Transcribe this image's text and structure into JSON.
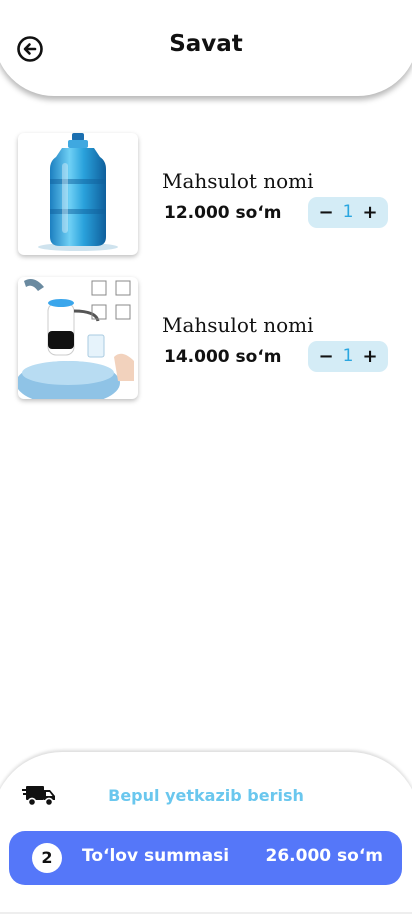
{
  "header": {
    "title": "Savat",
    "back_icon": "arrow-left-circle-icon"
  },
  "products": [
    {
      "name": "Mahsulot nomi",
      "price": "12.000 so‘m",
      "quantity": "1",
      "minus": "−",
      "plus": "+",
      "image": "water-bottle-image"
    },
    {
      "name": "Mahsulot nomi",
      "price": "14.000 so‘m",
      "quantity": "1",
      "minus": "−",
      "plus": "+",
      "image": "water-pump-image"
    }
  ],
  "footer": {
    "delivery_icon": "truck-icon",
    "delivery_text": "Bepul yetkazib berish",
    "item_count": "2",
    "pay_label": "To‘lov summasi",
    "total": "26.000 so‘m"
  },
  "colors": {
    "accent": "#5577f9",
    "stepper_bg": "#d4ecf6",
    "quantity": "#2aa6e0",
    "delivery_text": "#6ac7ee"
  }
}
